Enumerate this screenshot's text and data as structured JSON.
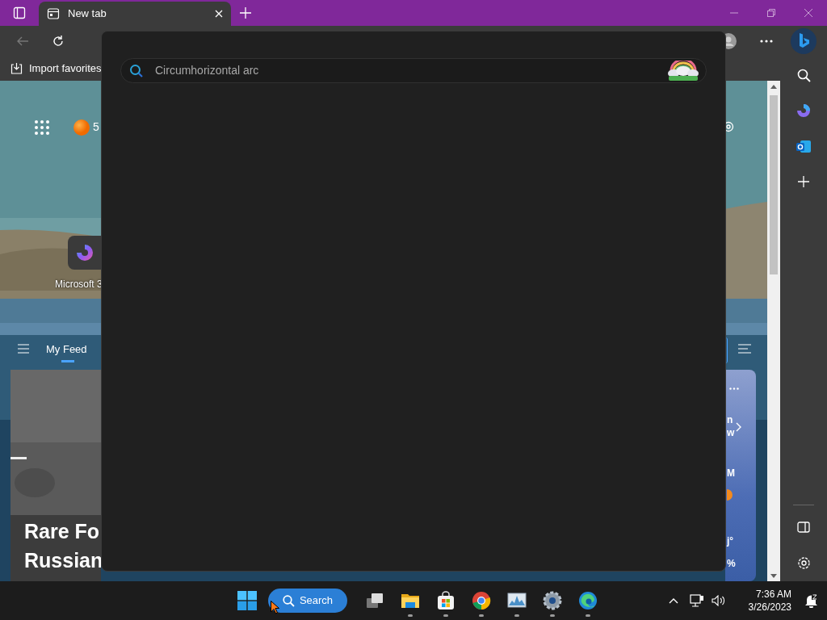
{
  "window": {
    "tabs": [
      {
        "title": "New tab",
        "selected": true
      }
    ]
  },
  "favorites_bar": {
    "items": [
      {
        "label": "Import favorites"
      }
    ]
  },
  "new_tab_page": {
    "rewards_points": "5",
    "tiles": [
      {
        "label": "Microsoft 3"
      }
    ],
    "feed_tabs": [
      {
        "label": "My Feed",
        "selected": true
      }
    ],
    "headline_lines": [
      "Rare Fo",
      "Russian"
    ],
    "weather_card_texts": [
      "n",
      "w",
      "M",
      "j°",
      "%"
    ]
  },
  "search_panel": {
    "placeholder": "Circumhorizontal arc"
  },
  "taskbar": {
    "search_label": "Search",
    "apps": [
      {
        "kind": "taskview",
        "running": false
      },
      {
        "kind": "folder",
        "running": true
      },
      {
        "kind": "store",
        "running": true
      },
      {
        "kind": "chrome",
        "running": true
      },
      {
        "kind": "monitor",
        "running": true
      },
      {
        "kind": "settings",
        "running": true
      },
      {
        "kind": "edge",
        "running": true
      }
    ],
    "time": "7:36 AM",
    "date": "3/26/2023"
  }
}
